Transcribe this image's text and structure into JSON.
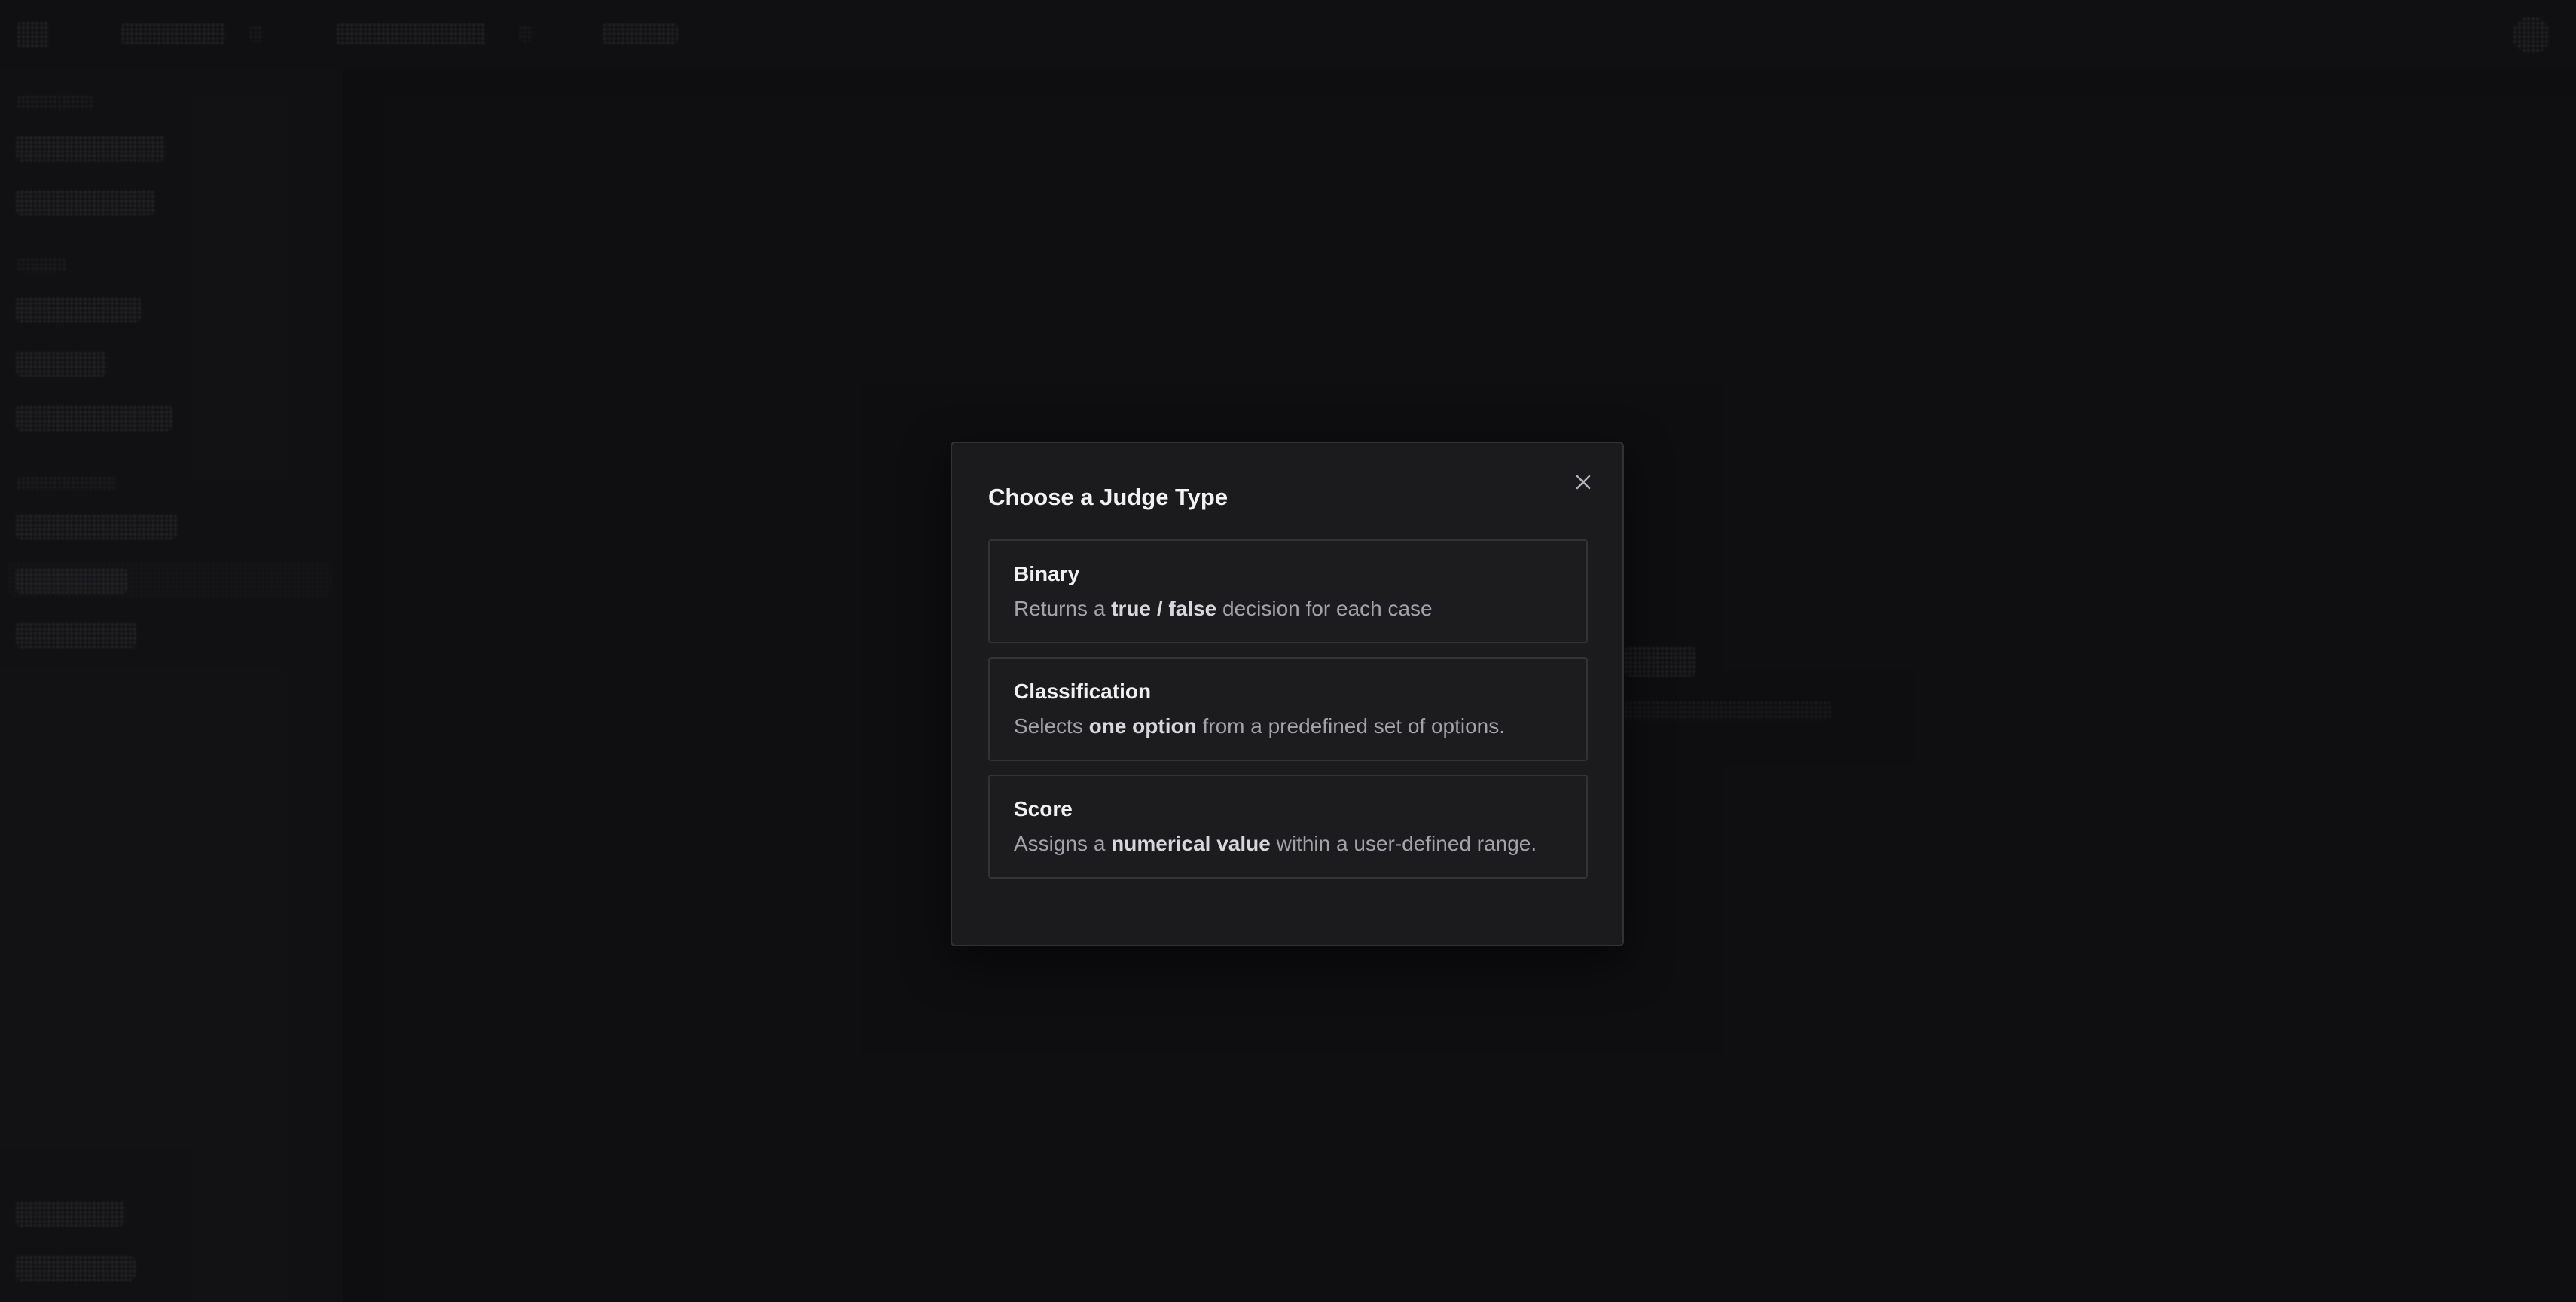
{
  "modal": {
    "title": "Choose a Judge Type",
    "close_icon": "close-icon",
    "options": [
      {
        "title": "Binary",
        "desc_before": "Returns a ",
        "desc_bold": "true / false",
        "desc_after": " decision for each case"
      },
      {
        "title": "Classification",
        "desc_before": "Selects ",
        "desc_bold": "one option",
        "desc_after": " from a predefined set of options."
      },
      {
        "title": "Score",
        "desc_before": "Assigns a ",
        "desc_bold": "numerical value",
        "desc_after": " within a user-defined range."
      }
    ]
  },
  "colors": {
    "background": "#121214",
    "modal_bg": "#1b1b1d",
    "modal_border": "#323236",
    "text_primary": "#f2f2f4",
    "text_secondary": "#a3a3aa"
  }
}
